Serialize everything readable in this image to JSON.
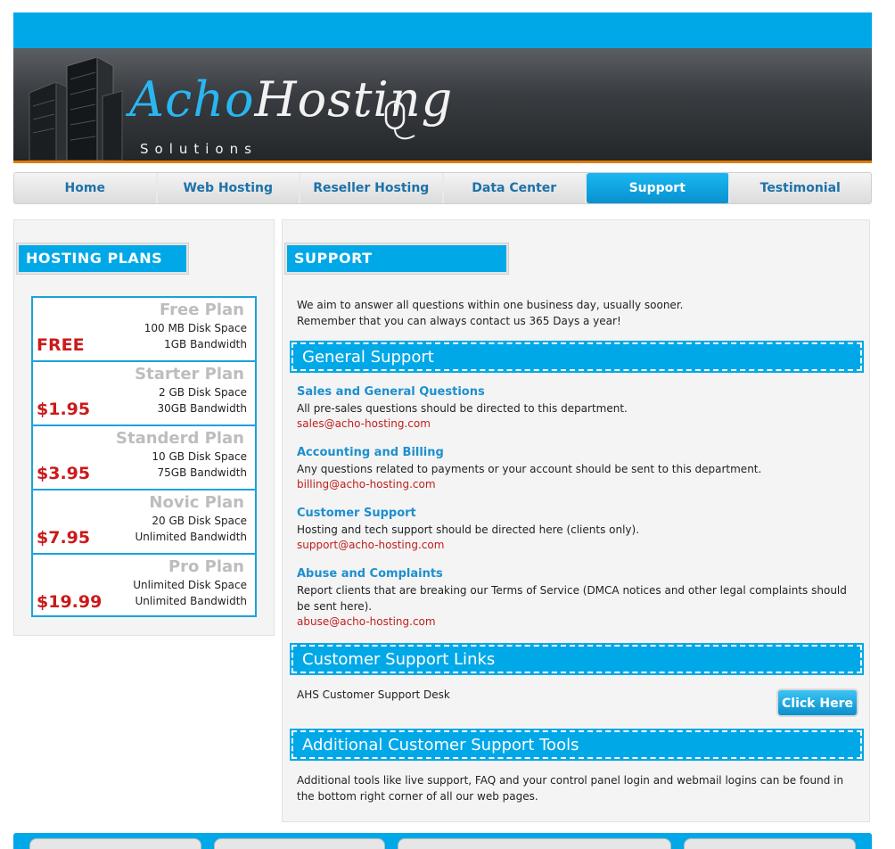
{
  "header": {
    "logo_acho": "Acho",
    "logo_hosting": "Hosting",
    "logo_sub": "Solutions"
  },
  "nav": {
    "items": [
      {
        "label": "Home"
      },
      {
        "label": "Web Hosting"
      },
      {
        "label": "Reseller Hosting"
      },
      {
        "label": "Data Center"
      },
      {
        "label": "Support"
      },
      {
        "label": "Testimonial"
      }
    ],
    "active": "Support"
  },
  "sidebar": {
    "title": "HOSTING PLANS",
    "plans": [
      {
        "name": "Free Plan",
        "disk": "100 MB Disk Space",
        "bandwidth": "1GB Bandwidth",
        "price": "FREE"
      },
      {
        "name": "Starter Plan",
        "disk": "2 GB Disk Space",
        "bandwidth": "30GB Bandwidth",
        "price": "$1.95"
      },
      {
        "name": "Standerd Plan",
        "disk": "10 GB Disk Space",
        "bandwidth": "75GB Bandwidth",
        "price": "$3.95"
      },
      {
        "name": "Novic Plan",
        "disk": "20 GB Disk Space",
        "bandwidth": "Unlimited Bandwidth",
        "price": "$7.95"
      },
      {
        "name": "Pro Plan",
        "disk": "Unlimited Disk Space",
        "bandwidth": "Unlimited Bandwidth",
        "price": "$19.99"
      }
    ]
  },
  "main": {
    "title": "SUPPORT",
    "intro_line1": "We aim to answer all questions within one business day, usually sooner.",
    "intro_line2": "Remember that you can always contact us 365 Days a year!",
    "general_title": "General Support",
    "departments": [
      {
        "heading": "Sales and General Questions",
        "text": "All pre-sales questions should be directed to this department.",
        "email": "sales@acho-hosting.com"
      },
      {
        "heading": "Accounting and Billing",
        "text": "Any questions related to payments or your account should be sent to this department.",
        "email": "billing@acho-hosting.com"
      },
      {
        "heading": "Customer Support",
        "text": "Hosting and tech support should be directed here (clients only).",
        "email": "support@acho-hosting.com"
      },
      {
        "heading": "Abuse and Complaints",
        "text": "Report clients that are breaking our Terms of Service (DMCA notices and other legal complaints should be sent here).",
        "email": "abuse@acho-hosting.com"
      }
    ],
    "links_title": "Customer Support Links",
    "desk_label": "AHS Customer Support Desk",
    "click_label": "Click Here",
    "tools_title": "Additional Customer Support Tools",
    "tools_text": "Additional tools like live support, FAQ and your control panel login and webmail logins can be found in the bottom right corner of all our web pages."
  },
  "colors": {
    "accent": "#00a8e8",
    "price_red": "#cc1a1a",
    "link_blue": "#1d8fce",
    "email_red": "#c0201e",
    "header_underline": "#e07b00"
  }
}
